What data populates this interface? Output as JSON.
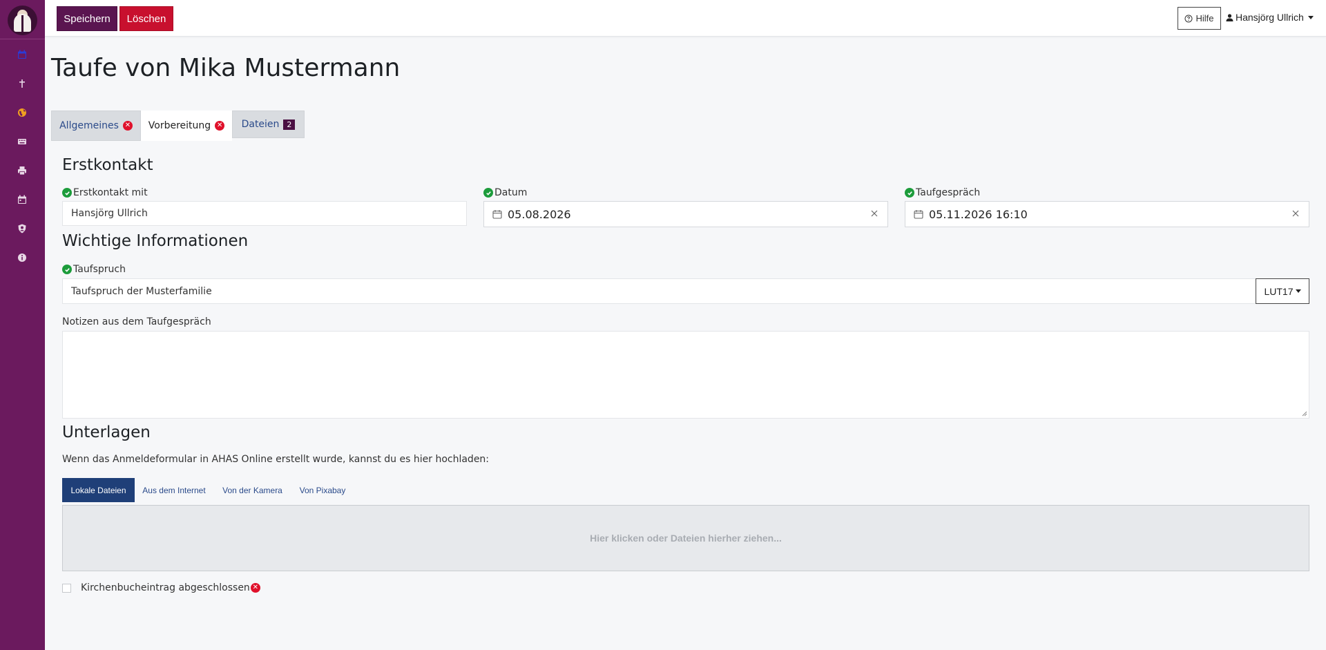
{
  "toolbar": {
    "save_label": "Speichern",
    "delete_label": "Löschen"
  },
  "header": {
    "help_label": "Hilfe",
    "user_name": "Hansjörg Ullrich"
  },
  "sidebar": {
    "items": [
      {
        "icon": "calendar-check-icon"
      },
      {
        "icon": "cross-icon"
      },
      {
        "icon": "globe-icon"
      },
      {
        "icon": "keyboard-icon"
      },
      {
        "icon": "printer-icon"
      },
      {
        "icon": "calendar-icon"
      },
      {
        "icon": "user-shield-icon"
      },
      {
        "icon": "info-icon"
      }
    ]
  },
  "page": {
    "title": "Taufe von Mika Mustermann"
  },
  "tabs": [
    {
      "label": "Allgemeines",
      "badge": "✕"
    },
    {
      "label": "Vorbereitung",
      "badge": "✕"
    },
    {
      "label": "Dateien",
      "badge": "2"
    }
  ],
  "sections": {
    "erstkontakt": "Erstkontakt",
    "wichtig": "Wichtige Informationen",
    "unterlagen": "Unterlagen"
  },
  "fields": {
    "erstkontakt_mit": {
      "label": "Erstkontakt mit",
      "value": "Hansjörg Ullrich"
    },
    "datum": {
      "label": "Datum",
      "value": "05.08.2026"
    },
    "taufgespraech": {
      "label": "Taufgespräch",
      "value": "05.11.2026 16:10"
    },
    "taufspruch": {
      "label": "Taufspruch",
      "value": "Taufspruch der Musterfamilie",
      "verse": "LUT17"
    },
    "notizen": {
      "label": "Notizen aus dem Taufgespräch",
      "value": ""
    }
  },
  "upload": {
    "hint": "Wenn das Anmeldeformular in AHAS Online erstellt wurde, kannst du es hier hochladen:",
    "tabs": [
      "Lokale Dateien",
      "Aus dem Internet",
      "Von der Kamera",
      "Von Pixabay"
    ],
    "dropzone": "Hier klicken oder Dateien hierher ziehen..."
  },
  "checkbox": {
    "label": "Kirchenbucheintrag abgeschlossen",
    "checked": false,
    "badge": "✕"
  },
  "colors": {
    "sidebar": "#6b1a5e",
    "save": "#5a1550",
    "delete": "#c8102e",
    "success": "#1c9c3b",
    "error": "#e0112b",
    "active_upload_tab": "#1f3f78"
  }
}
